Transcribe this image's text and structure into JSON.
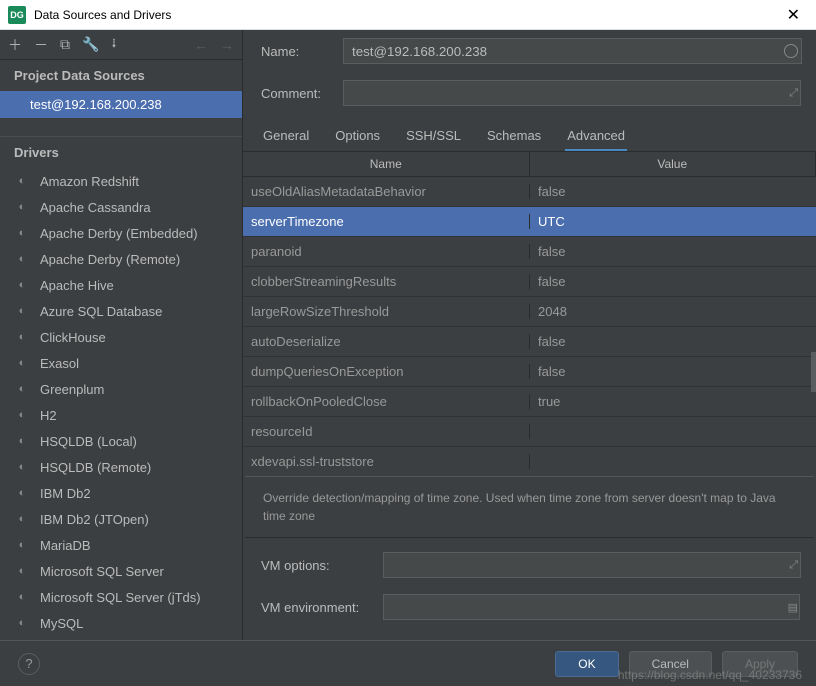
{
  "window": {
    "title": "Data Sources and Drivers"
  },
  "sidebar": {
    "sources_header": "Project Data Sources",
    "source_item": "test@192.168.200.238",
    "drivers_header": "Drivers",
    "drivers": [
      "Amazon Redshift",
      "Apache Cassandra",
      "Apache Derby (Embedded)",
      "Apache Derby (Remote)",
      "Apache Hive",
      "Azure SQL Database",
      "ClickHouse",
      "Exasol",
      "Greenplum",
      "H2",
      "HSQLDB (Local)",
      "HSQLDB (Remote)",
      "IBM Db2",
      "IBM Db2 (JTOpen)",
      "MariaDB",
      "Microsoft SQL Server",
      "Microsoft SQL Server (jTds)",
      "MySQL"
    ]
  },
  "form": {
    "name_label": "Name:",
    "name_value": "test@192.168.200.238",
    "comment_label": "Comment:",
    "comment_value": ""
  },
  "tabs": [
    "General",
    "Options",
    "SSH/SSL",
    "Schemas",
    "Advanced"
  ],
  "active_tab": "Advanced",
  "table": {
    "col_name": "Name",
    "col_value": "Value",
    "rows": [
      {
        "name": "useOldAliasMetadataBehavior",
        "value": "false",
        "selected": false
      },
      {
        "name": "serverTimezone",
        "value": "UTC",
        "selected": true
      },
      {
        "name": "paranoid",
        "value": "false",
        "selected": false
      },
      {
        "name": "clobberStreamingResults",
        "value": "false",
        "selected": false
      },
      {
        "name": "largeRowSizeThreshold",
        "value": "2048",
        "selected": false
      },
      {
        "name": "autoDeserialize",
        "value": "false",
        "selected": false
      },
      {
        "name": "dumpQueriesOnException",
        "value": "false",
        "selected": false
      },
      {
        "name": "rollbackOnPooledClose",
        "value": "true",
        "selected": false
      },
      {
        "name": "resourceId",
        "value": "",
        "selected": false
      },
      {
        "name": "xdevapi.ssl-truststore",
        "value": "",
        "selected": false
      }
    ]
  },
  "description": "Override detection/mapping of time zone. Used when time zone from server doesn't map to Java time zone",
  "vm": {
    "options_label": "VM options:",
    "env_label": "VM environment:"
  },
  "buttons": {
    "ok": "OK",
    "cancel": "Cancel",
    "apply": "Apply"
  },
  "watermark": "https://blog.csdn.net/qq_40233736"
}
